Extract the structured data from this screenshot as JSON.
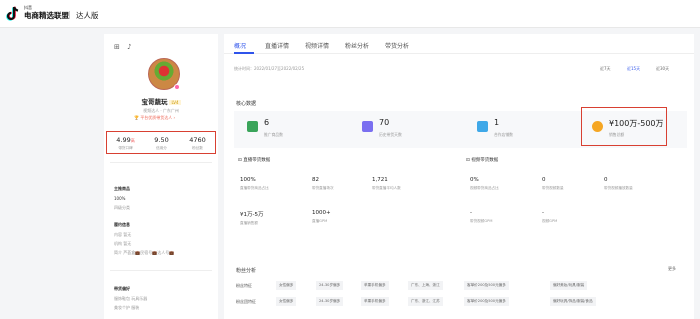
{
  "header": {
    "brand_small": "抖音",
    "brand": "电商精选联盟",
    "edition": "达人版"
  },
  "profile": {
    "top_icons": [
      "⊞",
      "♪"
    ],
    "name": "宝哥蔬玩",
    "level_badge": "LV4",
    "role": "视频达人 · 广东广州",
    "tag": "🏆 平台优质带货达人 ›",
    "stats": [
      {
        "value": "4.99",
        "unit": "高",
        "label": "带货口碑"
      },
      {
        "value": "9.50",
        "unit": "",
        "label": "信用分"
      },
      {
        "value": "4760",
        "unit": "",
        "label": "粉丝数"
      }
    ],
    "sections": [
      {
        "title": "主推商品",
        "lines": [
          {
            "bold": "100%",
            "text": ""
          },
          {
            "bold": "",
            "text": "四级分类"
          }
        ]
      },
      {
        "title": "履约信息",
        "lines": [
          {
            "bold": "",
            "text": "内容    暂无"
          },
          {
            "bold": "",
            "text": "机构    暂无"
          },
          {
            "bold": "",
            "text": "简介    芦荟盒💼民宿号💼达人号💼"
          }
        ]
      },
      {
        "title": "带货偏好",
        "lines": [
          {
            "bold": "",
            "text": "服饰鞋包    玩具乐器"
          },
          {
            "bold": "",
            "text": "美妆个护    服装"
          }
        ]
      }
    ]
  },
  "main": {
    "tabs": [
      "概况",
      "直播详情",
      "视频详情",
      "粉丝分析",
      "带货分析"
    ],
    "period": "统计时间：2022/01/27至2022/02/25",
    "ranges": [
      "近7天",
      "近15天",
      "近30天"
    ],
    "core_title": "核心数据",
    "kpis": [
      {
        "value": "6",
        "label": "推广商品数",
        "icon": "#3aa45a"
      },
      {
        "value": "70",
        "label": "历史带货天数",
        "icon": "#7a6ff0"
      },
      {
        "value": "1",
        "label": "合作店铺数",
        "icon": "#3fa8e8"
      },
      {
        "value": "¥100万-500万",
        "label": "销售总额",
        "icon": "#f5a623"
      }
    ],
    "live_title": "⊡ 直播带货数据",
    "live_cells": [
      {
        "value": "100%",
        "label": "直播带货商品占比"
      },
      {
        "value": "82",
        "label": "带货直播场次"
      },
      {
        "value": "1,721",
        "label": "带货直播平均人数"
      },
      {
        "value": "¥1万-5万",
        "label": "直播销售额"
      },
      {
        "value": "1000+",
        "label": "直播GPM"
      }
    ],
    "video_title": "⊡ 视频带货数据",
    "video_cells": [
      {
        "value": "0%",
        "label": "视频带货商品占比"
      },
      {
        "value": "0",
        "label": "带货视频数量"
      },
      {
        "value": "0",
        "label": "带货视频播放数量"
      },
      {
        "value": "-",
        "label": "带货视频GPM"
      },
      {
        "value": "-",
        "label": "视频GPM"
      }
    ],
    "fans_title": "粉丝分析",
    "fans_more": "更多",
    "fan_rows": [
      {
        "label": "粉丝特征",
        "tags": [
          "女性偏多",
          "24-30岁偏多",
          "苹果手机偏多",
          "广东、上海、浙江",
          "客单价200及500元偏多",
          "偏好美妆/玩具/服装"
        ]
      },
      {
        "label": "粉丝团特征",
        "tags": [
          "女性偏多",
          "24-30岁偏多",
          "苹果手机偏多",
          "广东、浙江、江苏",
          "客单价200及500元偏多",
          "偏好玩具/饰品/服装/食品"
        ]
      }
    ]
  }
}
